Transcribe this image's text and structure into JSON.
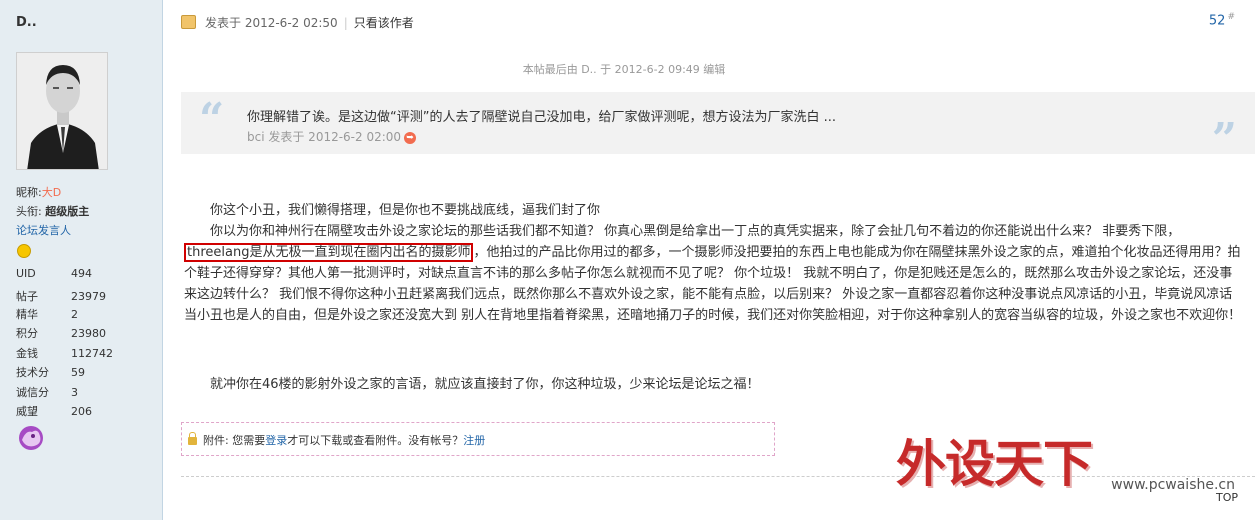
{
  "user": {
    "name": "D..",
    "nickname_label": "昵称:",
    "nickname": "大D",
    "title_label": "头衔:",
    "title": "超级版主",
    "group": "论坛发言人",
    "stats": [
      {
        "label": "UID",
        "value": "494"
      },
      {
        "label": "帖子",
        "value": "23979"
      },
      {
        "label": "精华",
        "value": "2"
      },
      {
        "label": "积分",
        "value": "23980"
      },
      {
        "label": "金钱",
        "value": "112742"
      },
      {
        "label": "技术分",
        "value": "59"
      },
      {
        "label": "诚信分",
        "value": "3"
      },
      {
        "label": "威望",
        "value": "206"
      }
    ]
  },
  "post": {
    "posted_at": "发表于 2012-6-2 02:50",
    "only_author": "只看该作者",
    "floor": "52",
    "floor_mark": "#",
    "edit_note": "本帖最后由 D.. 于 2012-6-2 09:49 编辑",
    "quote": {
      "text": "你理解错了诶。是这边做“评测”的人去了隔壁说自己没加电，给厂家做评测呢，想方设法为厂家洗白 ...",
      "by": "bci 发表于 2012-6-2 02:00"
    },
    "p1": "你这个小丑，我们懒得搭理，但是你也不要挑战底线，逼我们封了你",
    "p2_before": "你以为你和神州行在隔壁攻击外设之家论坛的那些话我们都不知道？ 你真心黑倒是给拿出一丁点的真凭实据来，除了会扯几句不着边的你还能说出什么来？ 非要秀下限，",
    "p2_highlight": "threelang是从无极一直到现在圈内出名的摄影师",
    "p2_after": "，他拍过的产品比你用过的都多，一个摄影师没把要拍的东西上电也能成为你在隔壁抹黑外设之家的点，难道拍个化妆品还得用用？拍个鞋子还得穿穿？其他人第一批测评时，对缺点直言不讳的那么多帖子你怎么就视而不见了呢？ 你个垃圾！ 我就不明白了，你是犯贱还是怎么的，既然那么攻击外设之家论坛，还没事来这边转什么？ 我们恨不得你这种小丑赶紧离我们远点，既然你那么不喜欢外设之家，能不能有点脸，以后别来？ 外设之家一直都容忍着你这种没事说点风凉话的小丑，毕竟说风凉话当小丑也是人的自由，但是外设之家还没宽大到 别人在背地里指着脊梁黑，还暗地捅刀子的时候，我们还对你笑脸相迎，对于你这种拿别人的宽容当纵容的垃圾，外设之家也不欢迎你！",
    "p3": "就冲你在46楼的影射外设之家的言语，就应该直接封了你，你这种垃圾，少来论坛是论坛之福！"
  },
  "attachment": {
    "label": "附件:",
    "text_before": " 您需要",
    "login": "登录",
    "text_mid": "才可以下载或查看附件。没有帐号？",
    "register": "注册"
  },
  "watermark": {
    "text": "外设天下",
    "url": "www.pcwaishe.cn"
  },
  "top_button": "TOP"
}
